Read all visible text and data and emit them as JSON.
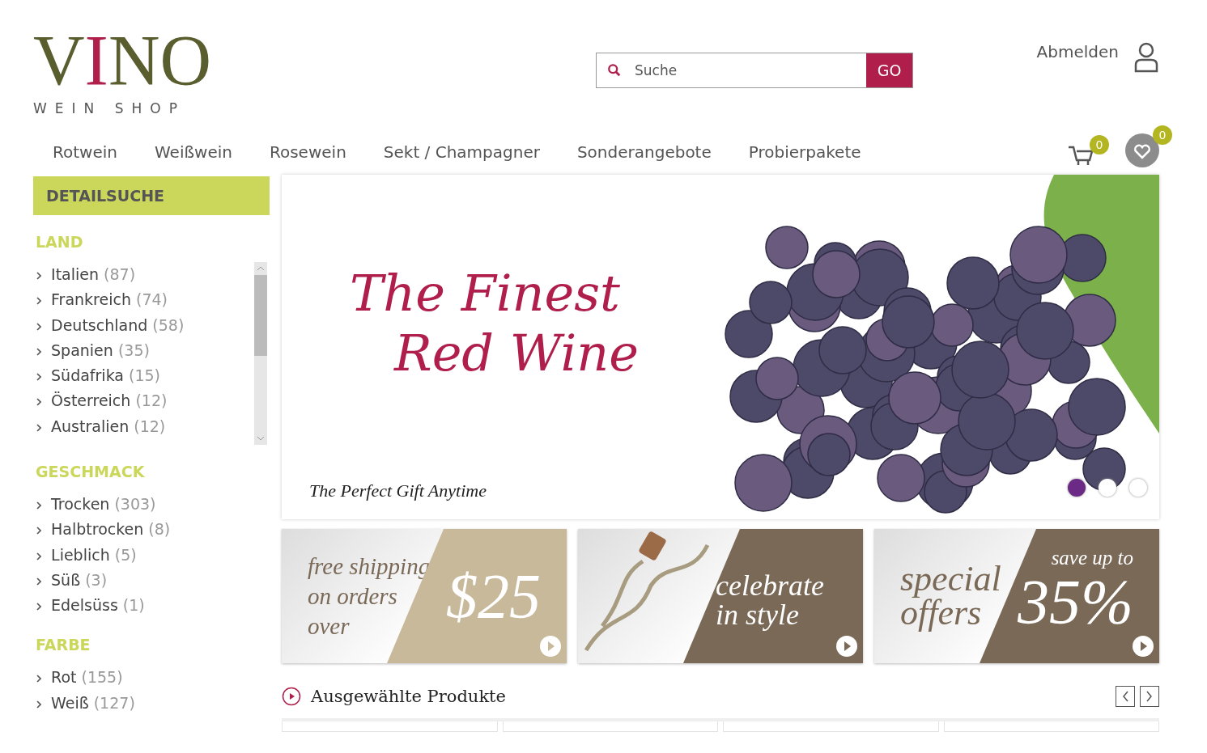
{
  "logo": {
    "word": "VINO",
    "tagline": "WEIN SHOP"
  },
  "search": {
    "placeholder": "Suche",
    "button": "GO"
  },
  "account": {
    "label": "Abmelden"
  },
  "nav": [
    "Rotwein",
    "Weißwein",
    "Rosewein",
    "Sekt / Champagner",
    "Sonderangebote",
    "Probierpakete"
  ],
  "cart": {
    "count": "0"
  },
  "wishlist": {
    "count": "0"
  },
  "sidebar": {
    "title": "DETAILSUCHE",
    "sections": [
      {
        "heading": "LAND",
        "scrollable": true,
        "items": [
          {
            "name": "Italien",
            "count": "(87)"
          },
          {
            "name": "Frankreich",
            "count": "(74)"
          },
          {
            "name": "Deutschland",
            "count": "(58)"
          },
          {
            "name": "Spanien",
            "count": "(35)"
          },
          {
            "name": "Südafrika",
            "count": "(15)"
          },
          {
            "name": "Österreich",
            "count": "(12)"
          },
          {
            "name": "Australien",
            "count": "(12)"
          }
        ]
      },
      {
        "heading": "GESCHMACK",
        "scrollable": false,
        "items": [
          {
            "name": "Trocken",
            "count": "(303)"
          },
          {
            "name": "Halbtrocken",
            "count": "(8)"
          },
          {
            "name": "Lieblich",
            "count": "(5)"
          },
          {
            "name": "Süß",
            "count": "(3)"
          },
          {
            "name": "Edelsüss",
            "count": "(1)"
          }
        ]
      },
      {
        "heading": "FARBE",
        "scrollable": false,
        "items": [
          {
            "name": "Rot",
            "count": "(155)"
          },
          {
            "name": "Weiß",
            "count": "(127)"
          }
        ]
      }
    ]
  },
  "hero": {
    "title_lines": [
      "The Finest",
      "Red Wine"
    ],
    "subtitle": "The Perfect Gift Anytime",
    "dots": [
      {
        "selected": true
      },
      {
        "selected": false
      },
      {
        "selected": false
      }
    ]
  },
  "promos": [
    {
      "kind": "text",
      "left_lines": [
        "free shipping",
        "on orders",
        "over"
      ],
      "right_big": "$25",
      "color": "#c8b99b"
    },
    {
      "kind": "photo",
      "right_big": "celebrate in style",
      "color": "#7a6957"
    },
    {
      "kind": "text",
      "left_lines": [
        "special",
        "offers"
      ],
      "right_small": "save up to",
      "right_big": "35%",
      "color": "#7a6957"
    }
  ],
  "products": {
    "heading": "Ausgewählte Produkte"
  }
}
